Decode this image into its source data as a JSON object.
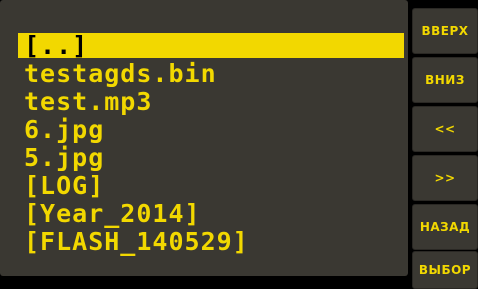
{
  "file_list": {
    "items": [
      {
        "label": "[..]"
      },
      {
        "label": "testagds.bin"
      },
      {
        "label": "test.mp3"
      },
      {
        "label": "6.jpg"
      },
      {
        "label": "5.jpg"
      },
      {
        "label": "[LOG]"
      },
      {
        "label": "[Year_2014]"
      },
      {
        "label": "[FLASH_140529]"
      }
    ],
    "selected_index": 0
  },
  "side_buttons": {
    "up": "ВВЕРХ",
    "down": "ВНИЗ",
    "page_prev": "<<",
    "page_next": ">>",
    "back": "НАЗАД",
    "select": "ВЫБОР"
  },
  "colors": {
    "text": "#f2d800",
    "panel": "#3a3832",
    "background": "#000000",
    "selection_bg": "#f2d800",
    "selection_text": "#000000"
  }
}
